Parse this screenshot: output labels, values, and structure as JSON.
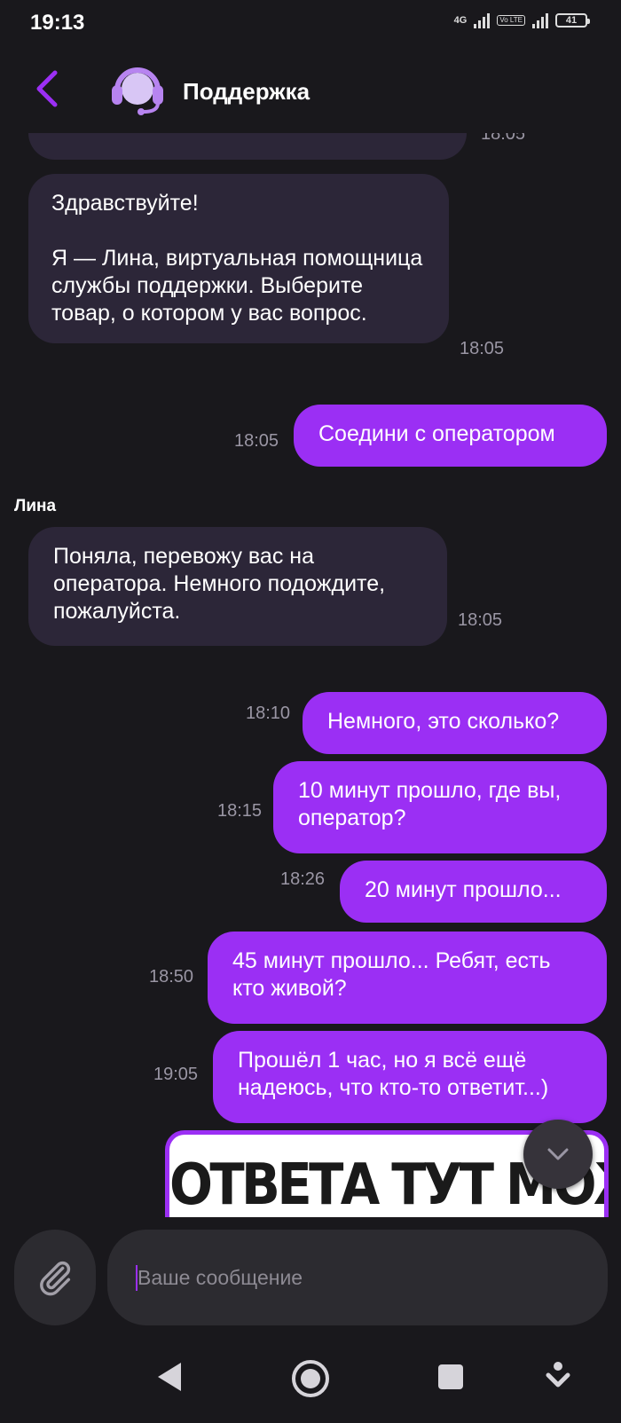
{
  "status_bar": {
    "time": "19:13",
    "network1": "4G",
    "network2": "Vo LTE",
    "battery": "41"
  },
  "header": {
    "title": "Поддержка"
  },
  "messages": [
    {
      "dir": "in",
      "text": "Здравствуйте!\n\nЯ — Лина, виртуальная помощница службы поддержки. Выберите товар, о котором у вас вопрос.",
      "time": "18:05"
    },
    {
      "dir": "out",
      "text": "Соедини с оператором",
      "time": "18:05"
    },
    {
      "dir": "in",
      "sender": "Лина",
      "text": "Поняла, перевожу вас на оператора. Немного подождите, пожалуйста.",
      "time": "18:05"
    },
    {
      "dir": "out",
      "text": "Немного, это сколько?",
      "time": "18:10"
    },
    {
      "dir": "out",
      "text": "10 минут прошло, где вы, оператор?",
      "time": "18:15"
    },
    {
      "dir": "out",
      "text": "20 минут прошло...",
      "time": "18:26"
    },
    {
      "dir": "out",
      "text": "45 минут прошло... Ребят, есть кто живой?",
      "time": "18:50"
    },
    {
      "dir": "out",
      "text": "Прошёл 1 час, но я всё ещё надеюсь, что кто-то ответит...)",
      "time": "19:05"
    }
  ],
  "partial_top_time": "18:05",
  "sticker": {
    "text": "ОТВЕТА ТУТ МОЖНО"
  },
  "composer": {
    "placeholder": "Ваше сообщение"
  },
  "colors": {
    "accent": "#9b2ff4",
    "incoming": "#2c2638",
    "background": "#19181c"
  }
}
